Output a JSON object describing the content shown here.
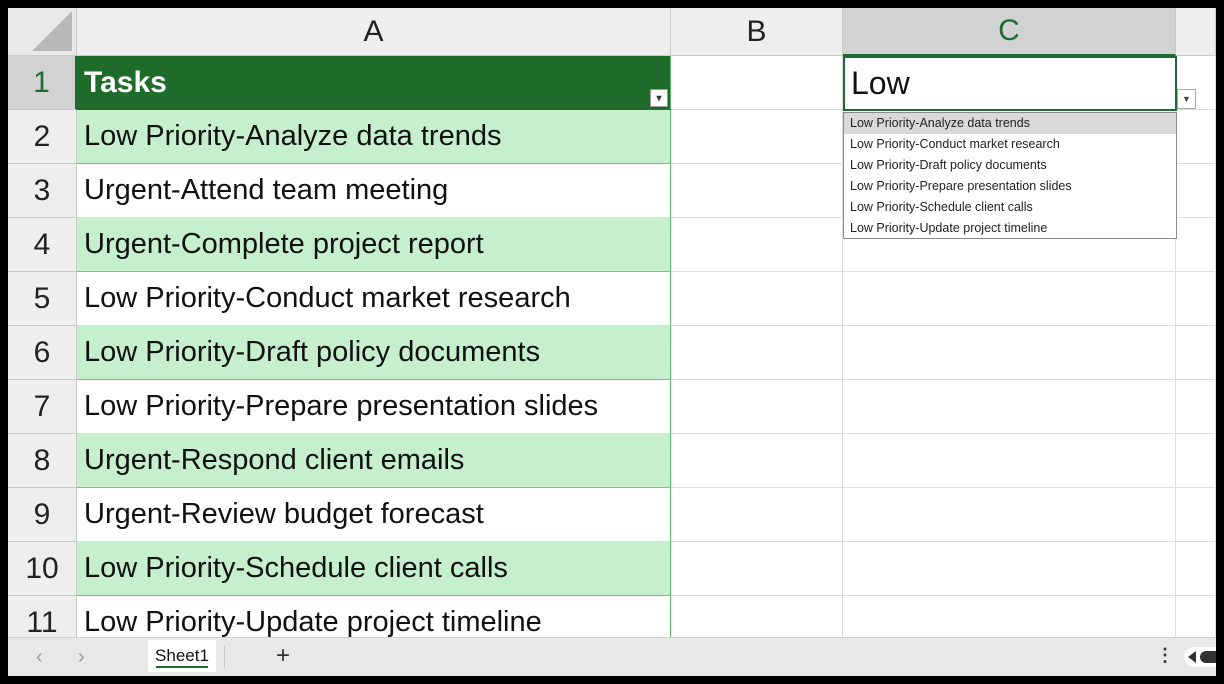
{
  "columns": [
    "A",
    "B",
    "C"
  ],
  "selected_column": "C",
  "rows": [
    "1",
    "2",
    "3",
    "4",
    "5",
    "6",
    "7",
    "8",
    "9",
    "10",
    "11"
  ],
  "selected_row": "1",
  "header_cell": "Tasks",
  "tasks": [
    "Low Priority-Analyze data trends",
    "Urgent-Attend team meeting",
    "Urgent-Complete project report",
    "Low Priority-Conduct market research",
    "Low Priority-Draft policy documents",
    "Low Priority-Prepare presentation slides",
    "Urgent-Respond client emails",
    "Urgent-Review budget forecast",
    "Low Priority-Schedule client calls",
    "Low Priority-Update project timeline"
  ],
  "active_cell_value": "Low",
  "dropdown_options": [
    "Low Priority-Analyze data trends",
    "Low Priority-Conduct market research",
    "Low Priority-Draft policy documents",
    "Low Priority-Prepare presentation slides",
    "Low Priority-Schedule client calls",
    "Low Priority-Update project timeline"
  ],
  "highlighted_option_index": 0,
  "sheet_tab": "Sheet1",
  "icons": {
    "prev_sheet": "chevron-left-icon",
    "next_sheet": "chevron-right-icon",
    "add_sheet": "plus-icon",
    "more": "more-vertical-icon",
    "filter": "filter-sort-icon",
    "dropdown": "dropdown-arrow-icon"
  },
  "colors": {
    "header_fill": "#1e6b2a",
    "band_fill": "#c6efce",
    "accent": "#1e6b32"
  }
}
